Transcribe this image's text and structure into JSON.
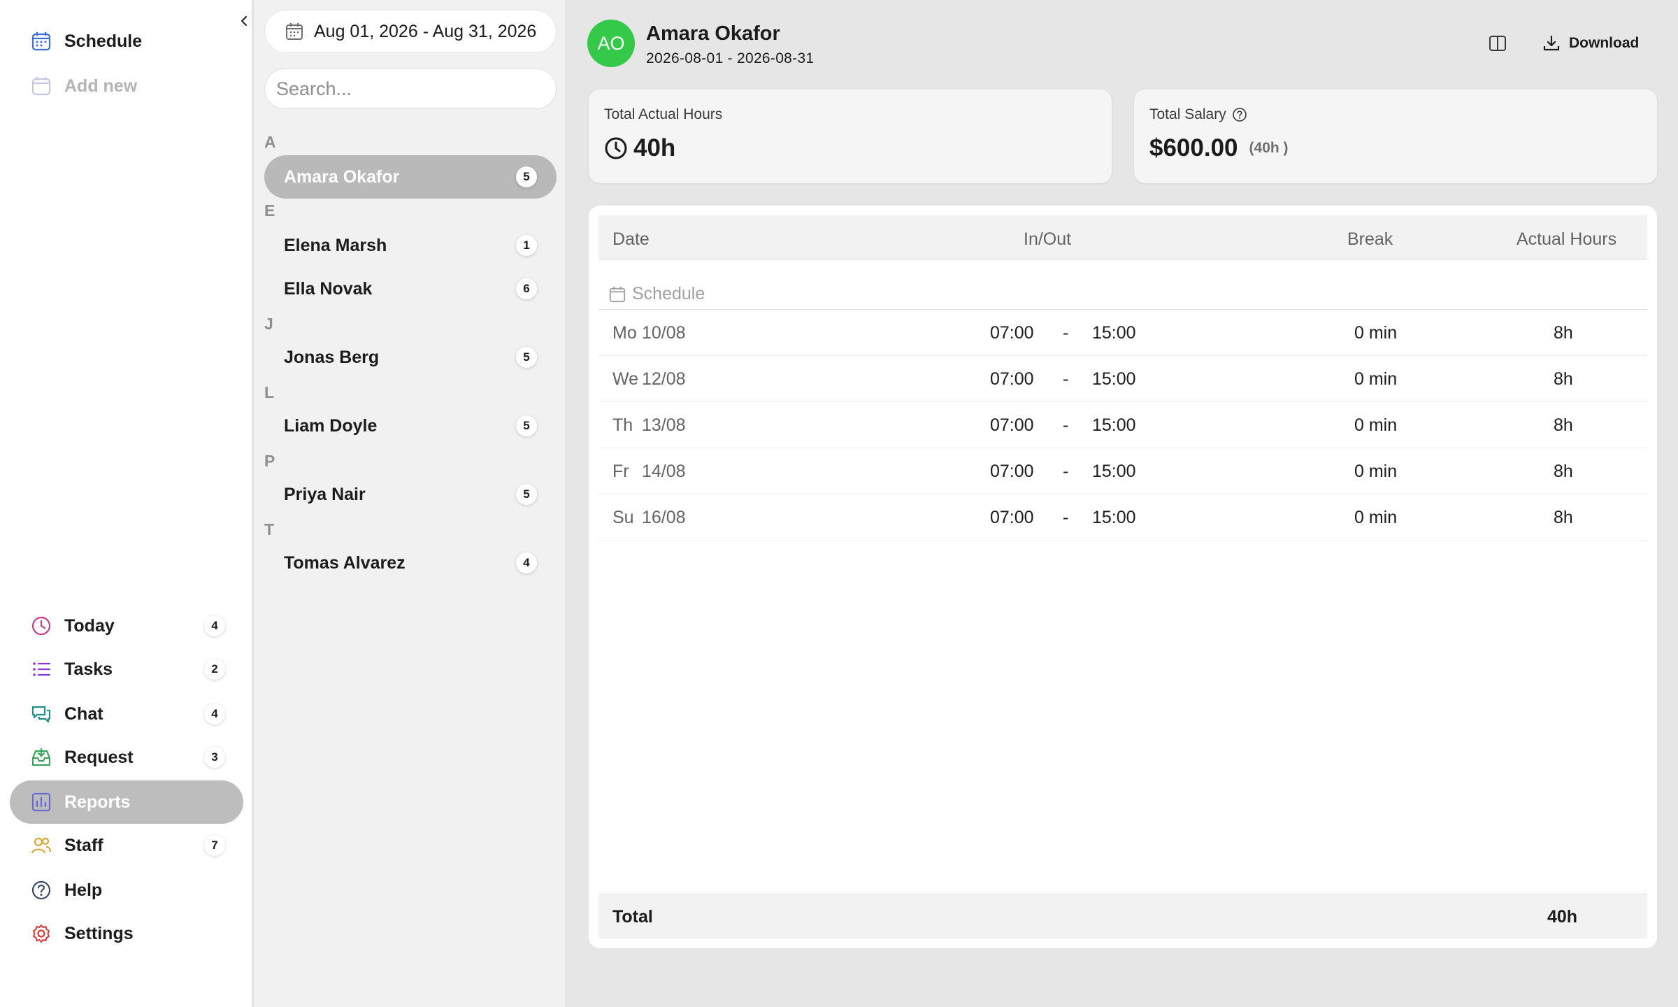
{
  "nav": {
    "top_items": [
      {
        "label": "Schedule",
        "icon": "calendar-icon"
      },
      {
        "label": "Add new",
        "icon": "calendar-plus-icon"
      }
    ],
    "bottom_items": [
      {
        "label": "Today",
        "count": "4",
        "icon": "clock-icon"
      },
      {
        "label": "Tasks",
        "count": "2",
        "icon": "list-icon"
      },
      {
        "label": "Chat",
        "count": "4",
        "icon": "chat-icon"
      },
      {
        "label": "Request",
        "count": "3",
        "icon": "inbox-icon"
      },
      {
        "label": "Reports",
        "icon": "bar-chart-icon"
      },
      {
        "label": "Staff",
        "count": "7",
        "icon": "users-icon"
      },
      {
        "label": "Help",
        "icon": "help-circle-icon"
      },
      {
        "label": "Settings",
        "icon": "gear-icon"
      }
    ],
    "active": "Reports",
    "colors": {
      "schedule": "#3b6fd6",
      "today": "#c43b8a",
      "tasks": "#8a3bd6",
      "chat": "#1f8f8a",
      "request": "#3aa55a",
      "reports": "#6a6ad6",
      "staff": "#d6a93b",
      "help": "#3a4a6a",
      "settings": "#d63b3b"
    }
  },
  "filters": {
    "date_range": "Aug 01, 2026 - Aug 31, 2026",
    "search_placeholder": "Search..."
  },
  "staff_groups": [
    {
      "letter": "A",
      "members": [
        {
          "name": "Amara Okafor",
          "count": "5",
          "active": true
        }
      ]
    },
    {
      "letter": "E",
      "members": [
        {
          "name": "Elena Marsh",
          "count": "1"
        },
        {
          "name": "Ella Novak",
          "count": "6"
        }
      ]
    },
    {
      "letter": "J",
      "members": [
        {
          "name": "Jonas Berg",
          "count": "5"
        }
      ]
    },
    {
      "letter": "L",
      "members": [
        {
          "name": "Liam Doyle",
          "count": "5"
        }
      ]
    },
    {
      "letter": "P",
      "members": [
        {
          "name": "Priya Nair",
          "count": "5"
        }
      ]
    },
    {
      "letter": "T",
      "members": [
        {
          "name": "Tomas Alvarez",
          "count": "4"
        }
      ]
    }
  ],
  "employee": {
    "initials": "AO",
    "name": "Amara Okafor",
    "period": "2026-08-01 - 2026-08-31",
    "avatar_color": "#35c94a"
  },
  "actions": {
    "download_label": "Download"
  },
  "summary": {
    "hours_caption": "Total Actual Hours",
    "hours_value": "40h",
    "salary_caption": "Total Salary",
    "salary_value": "$600.00",
    "salary_sub": "(40h )"
  },
  "table": {
    "headers": {
      "date": "Date",
      "inout": "In/Out",
      "break": "Break",
      "hours": "Actual Hours"
    },
    "section_label": "Schedule",
    "rows": [
      {
        "day": "Mo",
        "date": "10/08",
        "in": "07:00",
        "sep": "-",
        "out": "15:00",
        "break": "0 min",
        "hours": "8h"
      },
      {
        "day": "We",
        "date": "12/08",
        "in": "07:00",
        "sep": "-",
        "out": "15:00",
        "break": "0 min",
        "hours": "8h"
      },
      {
        "day": "Th",
        "date": "13/08",
        "in": "07:00",
        "sep": "-",
        "out": "15:00",
        "break": "0 min",
        "hours": "8h"
      },
      {
        "day": "Fr",
        "date": "14/08",
        "in": "07:00",
        "sep": "-",
        "out": "15:00",
        "break": "0 min",
        "hours": "8h"
      },
      {
        "day": "Su",
        "date": "16/08",
        "in": "07:00",
        "sep": "-",
        "out": "15:00",
        "break": "0 min",
        "hours": "8h"
      }
    ],
    "total_label": "Total",
    "total_hours": "40h"
  }
}
